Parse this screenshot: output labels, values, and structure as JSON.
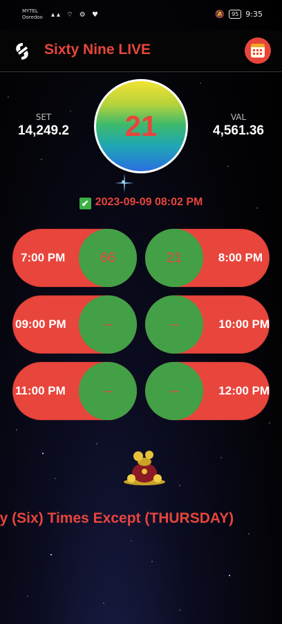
{
  "status_bar": {
    "carrier_line1": "MYTEL",
    "carrier_line2": "Ooredoo",
    "icons": "▴▴ ⌔ ⚙ ♥",
    "battery": "95",
    "time": "9:35"
  },
  "app": {
    "title": "Sixty Nine LIVE",
    "accent_color": "#e8453c",
    "ball_color": "#43a047"
  },
  "live": {
    "set_label": "SET",
    "set_value": "14,249.2",
    "val_label": "VAL",
    "val_value": "4,561.36",
    "result": "21",
    "check_icon": "✔",
    "updated": "2023-09-09 08:02 PM"
  },
  "draws": [
    {
      "time": "7:00 PM",
      "number": "66"
    },
    {
      "time": "8:00 PM",
      "number": "21"
    },
    {
      "time": "09:00 PM",
      "number": "--"
    },
    {
      "time": "10:00 PM",
      "number": "--"
    },
    {
      "time": "11:00 PM",
      "number": "--"
    },
    {
      "time": "12:00 PM",
      "number": "--"
    }
  ],
  "marquee": "ily (Six) Times Except (THURSDAY)"
}
